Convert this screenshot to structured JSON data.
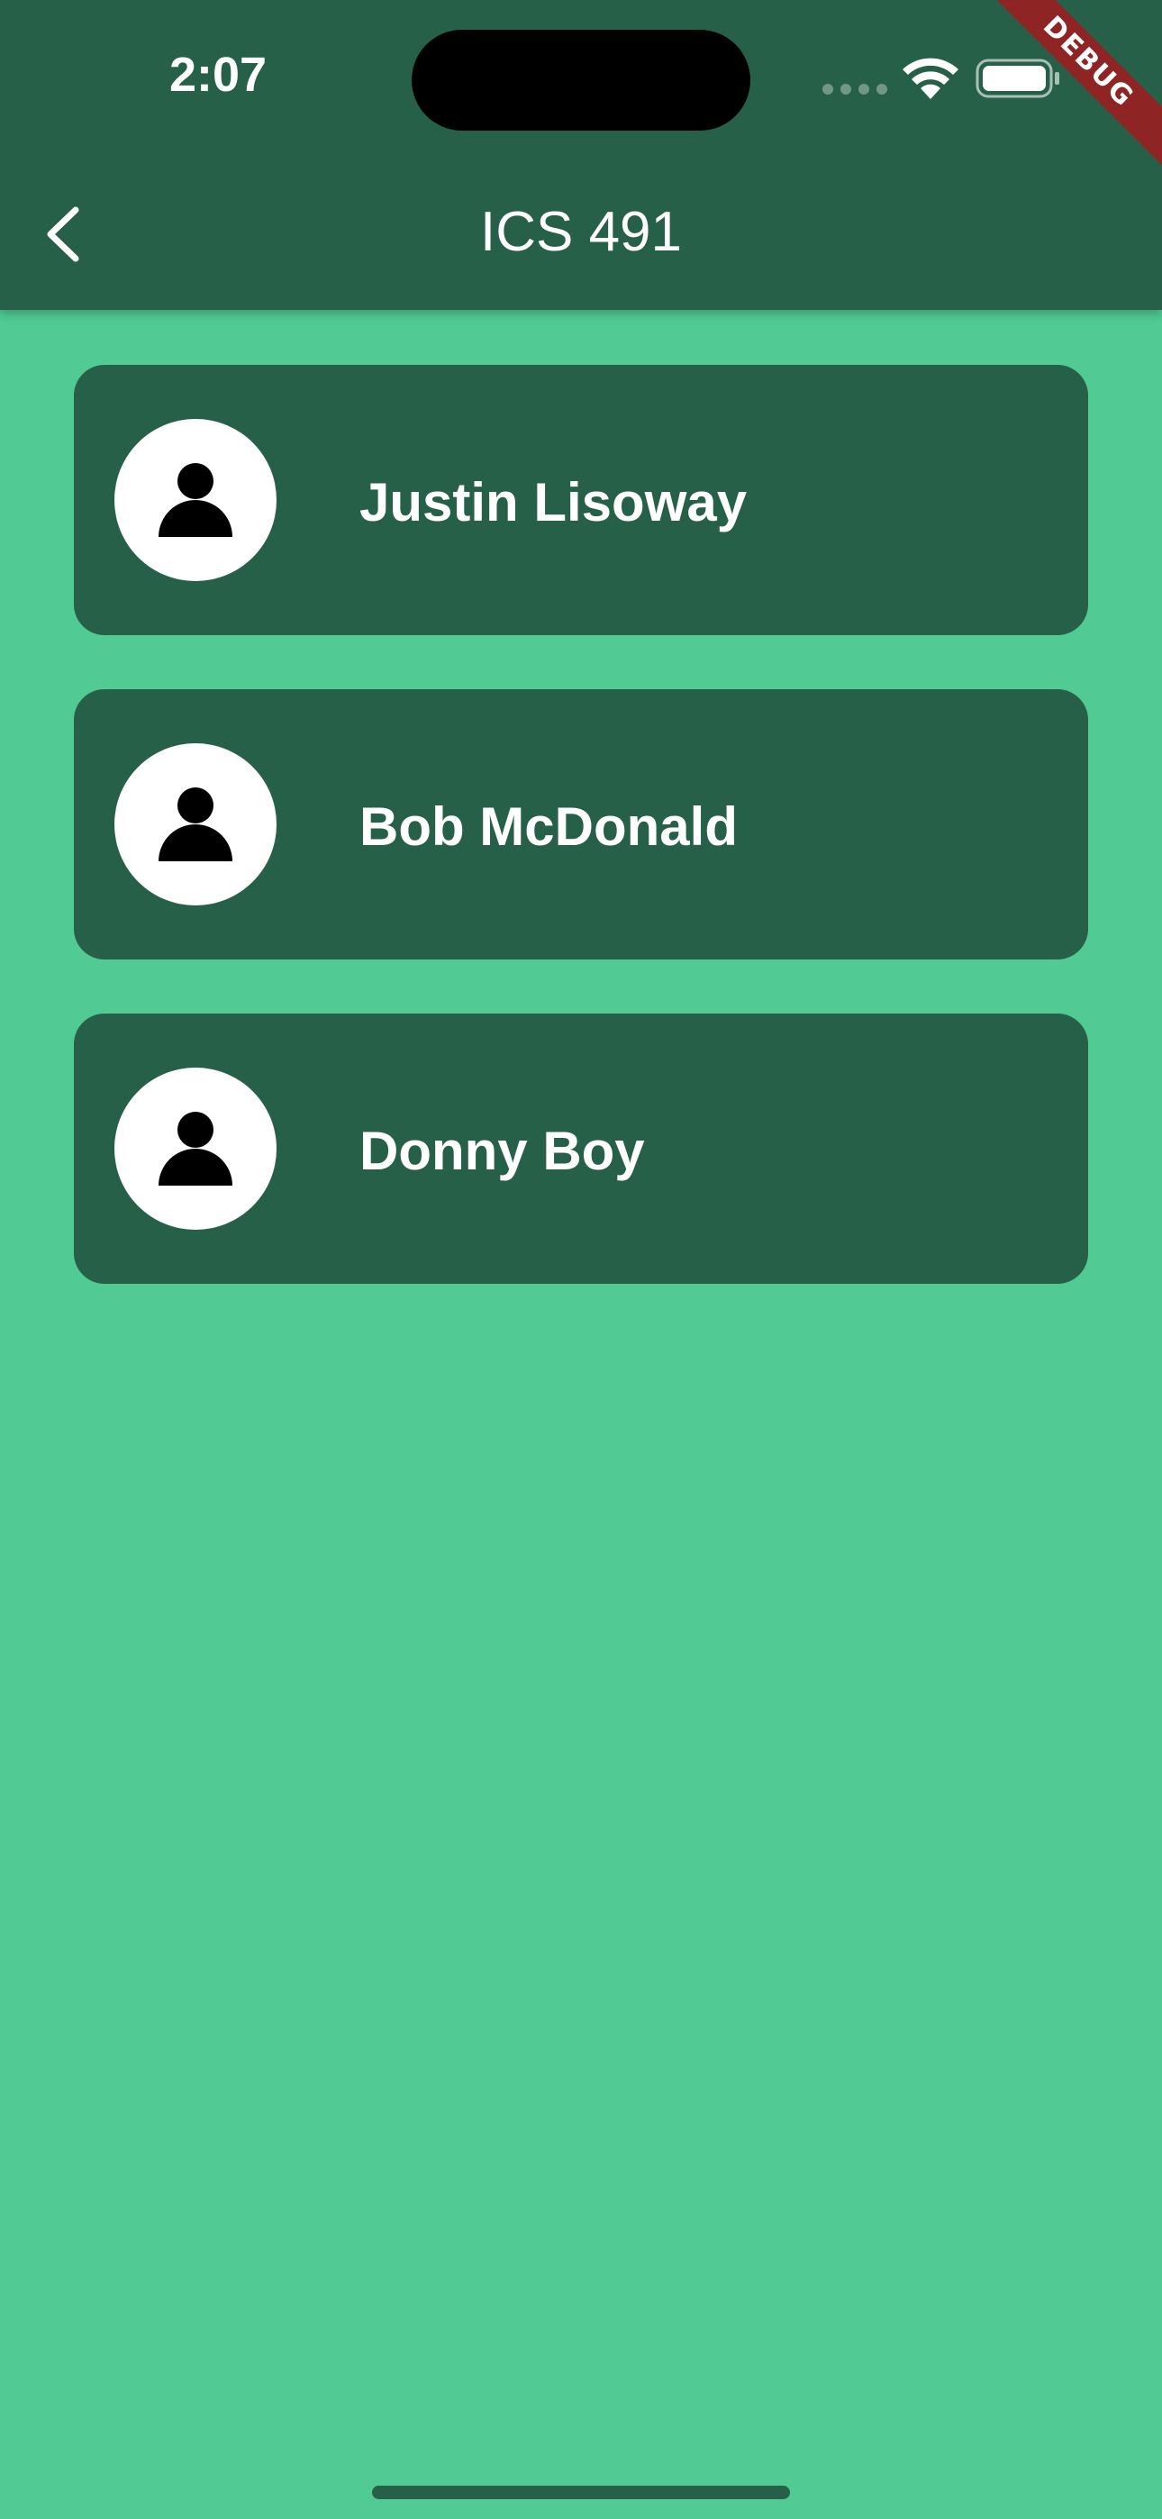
{
  "status_bar": {
    "time": "2:07",
    "signal_icon": "cellular-signal-icon",
    "wifi_icon": "wifi-icon",
    "battery_icon": "battery-icon"
  },
  "debug_banner": "DEBUG",
  "app_bar": {
    "title": "ICS 491",
    "back_icon": "chevron-left-icon"
  },
  "contacts": [
    {
      "name": "Justin Lisoway",
      "icon": "person-icon"
    },
    {
      "name": "Bob McDonald",
      "icon": "person-icon"
    },
    {
      "name": "Donny Boy",
      "icon": "person-icon"
    }
  ],
  "colors": {
    "background": "#51CA94",
    "primary_dark": "#276049",
    "debug_banner": "#8E2424",
    "text": "#FFFFFF"
  }
}
